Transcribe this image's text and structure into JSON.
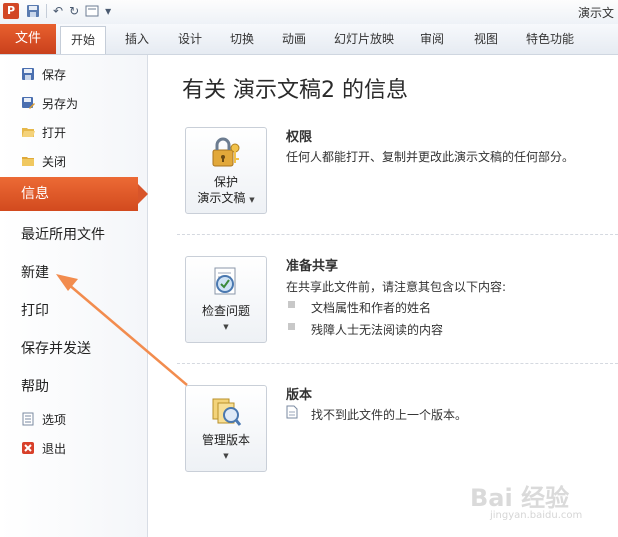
{
  "window": {
    "title": "演示文"
  },
  "qat": {
    "logo": "P",
    "save_icon": "save-icon",
    "undo_glyph": "↶",
    "redo_glyph": "↻",
    "customize_glyph": "▾"
  },
  "ribbon": {
    "file_tab": "文件",
    "tabs": [
      "开始",
      "插入",
      "设计",
      "切换",
      "动画",
      "幻灯片放映",
      "审阅",
      "视图",
      "特色功能"
    ],
    "active_tab": "开始"
  },
  "backstage": {
    "commands_top": [
      {
        "label": "保存",
        "icon": "save-icon"
      },
      {
        "label": "另存为",
        "icon": "save-as-icon"
      },
      {
        "label": "打开",
        "icon": "open-folder-icon"
      },
      {
        "label": "关闭",
        "icon": "close-folder-icon"
      }
    ],
    "selected": "信息",
    "sections": [
      "最近所用文件",
      "新建",
      "打印",
      "保存并发送",
      "帮助"
    ],
    "commands_bottom": [
      {
        "label": "选项",
        "icon": "options-icon"
      },
      {
        "label": "退出",
        "icon": "exit-icon"
      }
    ]
  },
  "info": {
    "page_title": "有关 演示文稿2 的信息",
    "permissions": {
      "button_line1": "保护",
      "button_line2": "演示文稿",
      "title": "权限",
      "description": "任何人都能打开、复制并更改此演示文稿的任何部分。"
    },
    "prepare": {
      "button_line1": "检查问题",
      "title": "准备共享",
      "description": "在共享此文件前，请注意其包含以下内容:",
      "bullets": [
        "文档属性和作者的姓名",
        "残障人士无法阅读的内容"
      ]
    },
    "versions": {
      "button_line1": "管理版本",
      "title": "版本",
      "description": "找不到此文件的上一个版本。"
    }
  },
  "watermark": {
    "brand": "Bai 经验",
    "url": "jingyan.baidu.com"
  },
  "colors": {
    "accent": "#d24a1e",
    "arrow": "#f28c4e"
  }
}
